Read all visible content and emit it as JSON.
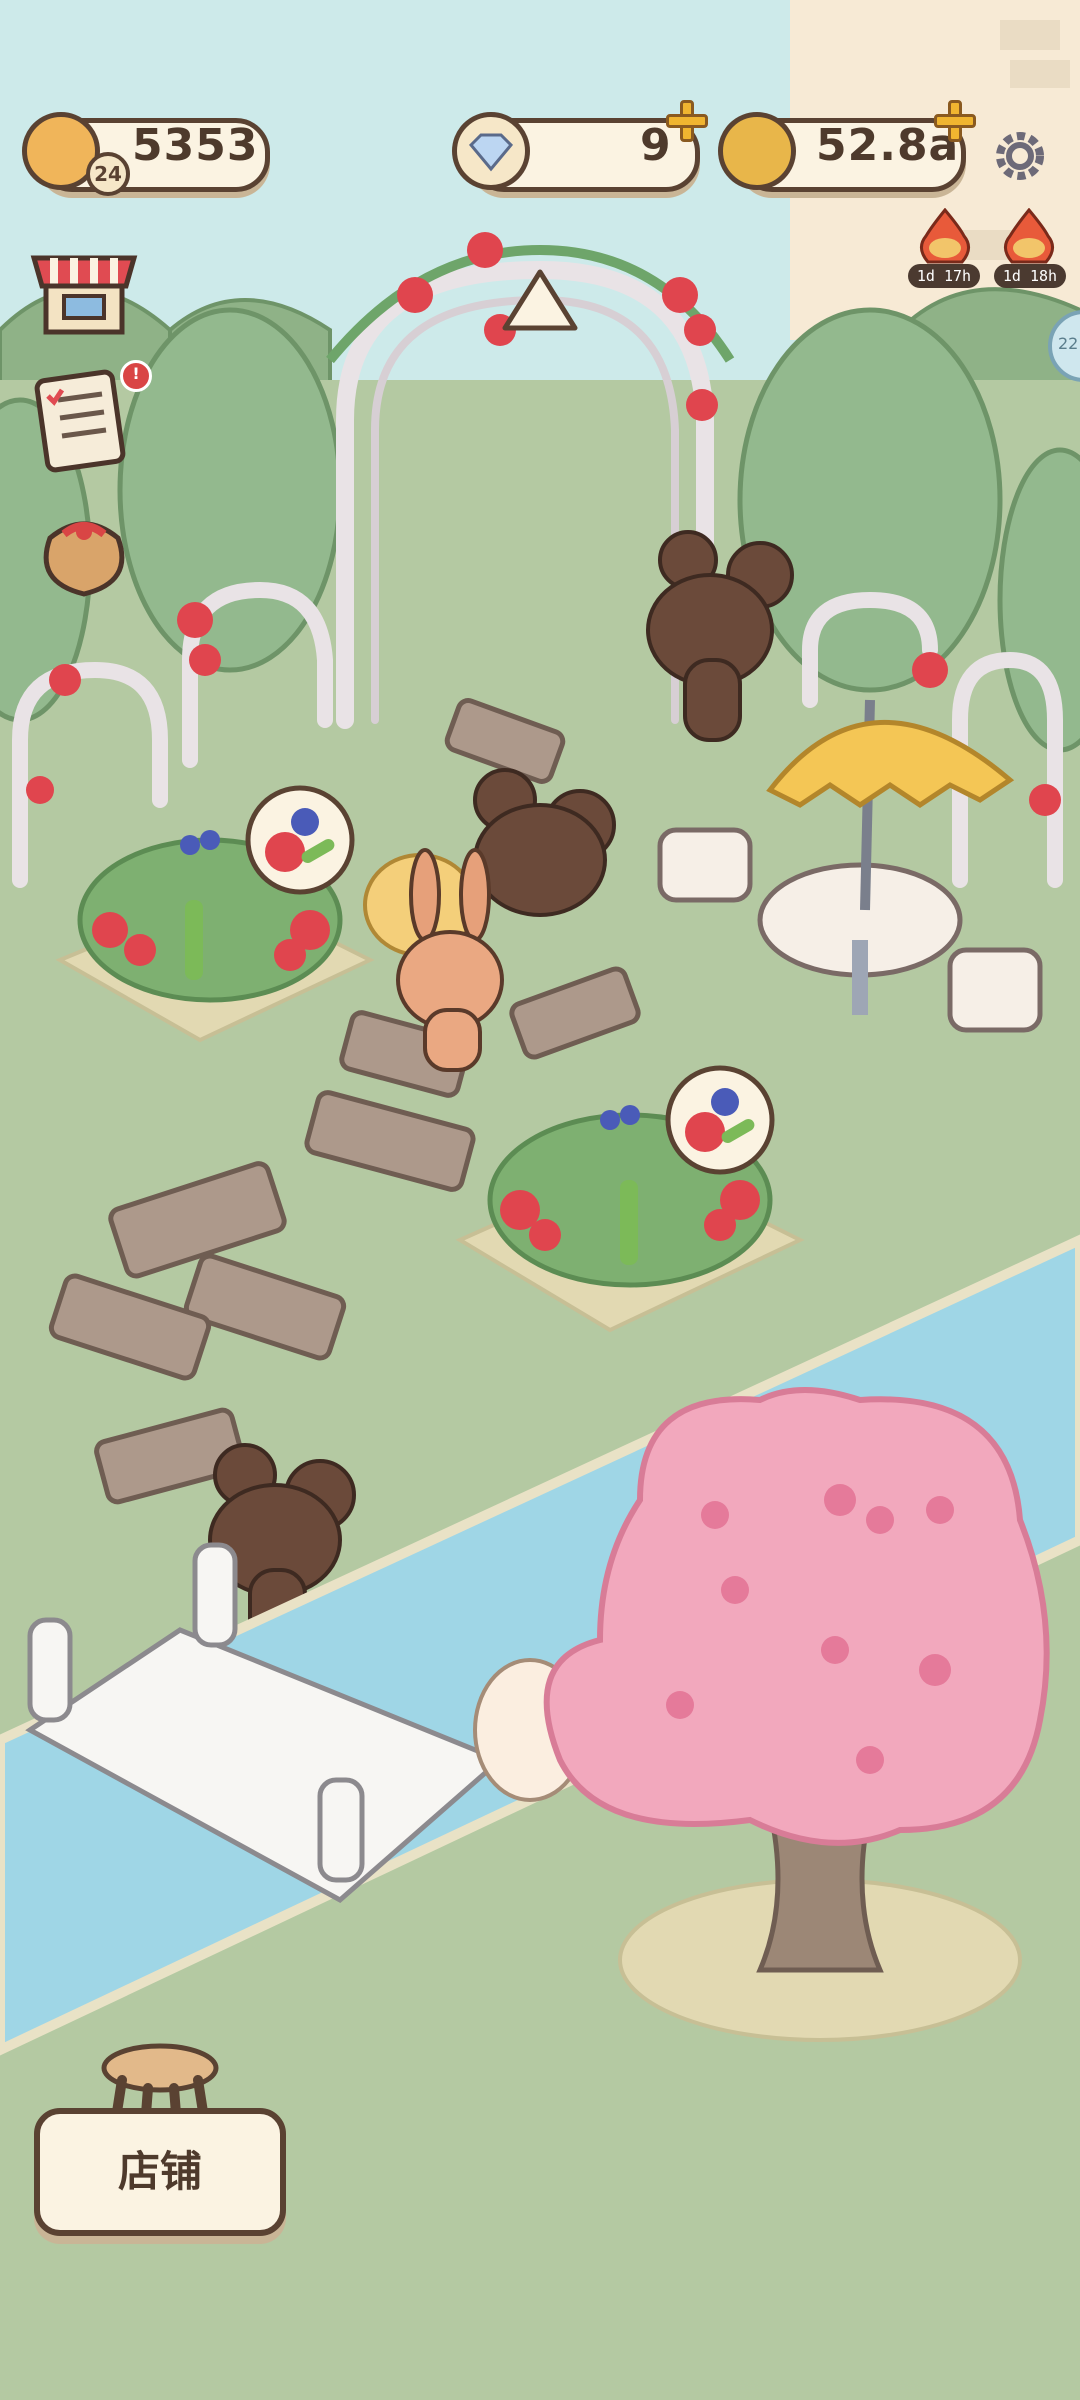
{
  "hud": {
    "coins": {
      "value": "5353",
      "level": "24",
      "icon": "bread-coin-icon"
    },
    "gems": {
      "value": "9",
      "icon": "diamond-icon"
    },
    "gold": {
      "value": "52.8a",
      "icon": "gold-coin-icon"
    },
    "settings_icon": "gear-icon",
    "event_timers": [
      {
        "label": "1d 17h",
        "icon": "fire-bread-icon"
      },
      {
        "label": "1d 18h",
        "icon": "fire-bread-icon"
      }
    ],
    "edge_badge": "22"
  },
  "side_menu": {
    "items": [
      {
        "icon": "shop-stall-icon"
      },
      {
        "icon": "task-list-icon",
        "badge": "!"
      },
      {
        "icon": "gift-bag-icon"
      }
    ]
  },
  "bottom": {
    "shop_button_label": "店铺"
  },
  "colors": {
    "sky": "#cdeaea",
    "grass": "#b4c9a2",
    "river": "#9fd6e6",
    "hud_border": "#5a4232",
    "hud_fill": "#fbf3e2",
    "accent_plus": "#f0b530",
    "cherry_blossom": "#f2a8bd"
  }
}
